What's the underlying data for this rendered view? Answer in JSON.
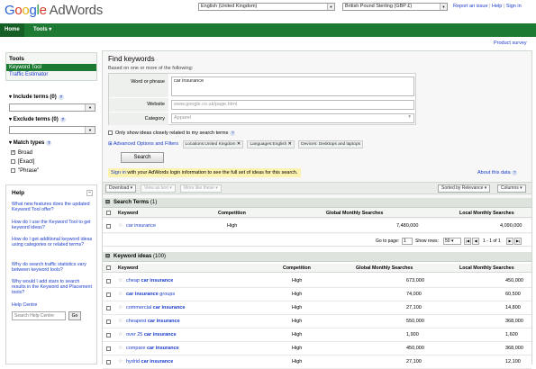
{
  "header": {
    "logo_google": [
      "G",
      "o",
      "o",
      "g",
      "l",
      "e"
    ],
    "logo_product": "AdWords",
    "language": "English (United Kingdom)",
    "currency": "British Pound Sterling (GBP £)",
    "links": [
      "Report an issue",
      "Help",
      "Sign in"
    ],
    "sep": "|"
  },
  "nav": {
    "home": "Home",
    "tools": "Tools"
  },
  "survey": "Product survey",
  "sidebar": {
    "tools_title": "Tools",
    "keyword_tool": "Keyword Tool",
    "traffic_estimator": "Traffic Estimator",
    "include_terms": "Include terms (0)",
    "exclude_terms": "Exclude terms (0)",
    "match_types": "Match types",
    "match_options": [
      {
        "label": "Broad",
        "checked": true
      },
      {
        "label": "[Exact]",
        "checked": false
      },
      {
        "label": "\"Phrase\"",
        "checked": false
      }
    ],
    "help_title": "Help",
    "help_links": [
      "What new features does the updated Keyword Tool offer?",
      "How do I use the Keyword Tool to get keyword ideas?",
      "How do I get additional keyword ideas using categories or related terms?",
      "Why do search traffic statistics vary between keyword tools?",
      "Why would I add stars to search results in the Keyword and Placement tools?",
      "Help Centre"
    ],
    "help_search_placeholder": "Search Help Centre",
    "go": "Go"
  },
  "find": {
    "title": "Find keywords",
    "subtitle": "Based on one or more of the following:",
    "word_label": "Word or phrase",
    "word_value": "car insurance",
    "website_label": "Website",
    "website_placeholder": "www.google.co.uk/page.html",
    "category_label": "Category",
    "category_placeholder": "Apparel",
    "only_closely": "Only show ideas closely related to my search terms",
    "advanced": "Advanced Options and Filters",
    "chips": [
      "Locations:United Kingdom",
      "Languages:English",
      "Devices: Desktops and laptops"
    ],
    "search_btn": "Search",
    "signin_link": "Sign in",
    "signin_text": " with your AdWords login information to see the full set of ideas for this search.",
    "about": "About this data"
  },
  "toolbar": {
    "download": "Download",
    "view_as_text": "View as text",
    "more_like_these": "More like these",
    "sort": "Sorted by Relevance",
    "columns": "Columns"
  },
  "search_terms": {
    "title": "Search Terms",
    "count": "(1)",
    "headers": [
      "Keyword",
      "Competition",
      "Global Monthly Searches",
      "Local Monthly Searches"
    ],
    "rows": [
      {
        "keyword": "car insurance",
        "competition": "High",
        "global": "7,480,000",
        "local": "4,090,000"
      }
    ]
  },
  "pager": {
    "goto": "Go to page:",
    "page": "1",
    "show_rows": "Show rows:",
    "rows": "50",
    "range": "1 - 1 of 1"
  },
  "keyword_ideas": {
    "title": "Keyword ideas",
    "count": "(100)",
    "headers": [
      "Keyword",
      "Competition",
      "Global Monthly Searches",
      "Local Monthly Searches"
    ],
    "rows": [
      {
        "pre": "cheap ",
        "kw": "car insurance",
        "post": "",
        "competition": "High",
        "global": "673,000",
        "local": "450,000"
      },
      {
        "pre": "",
        "kw": "car insurance",
        "post": " groups",
        "competition": "High",
        "global": "74,000",
        "local": "60,500"
      },
      {
        "pre": "commercial ",
        "kw": "car insurance",
        "post": "",
        "competition": "High",
        "global": "27,100",
        "local": "14,800"
      },
      {
        "pre": "cheapest ",
        "kw": "car insurance",
        "post": "",
        "competition": "High",
        "global": "550,000",
        "local": "368,000"
      },
      {
        "pre": "over 25 ",
        "kw": "car insurance",
        "post": "",
        "competition": "High",
        "global": "1,900",
        "local": "1,600"
      },
      {
        "pre": "compare ",
        "kw": "car insurance",
        "post": "",
        "competition": "High",
        "global": "450,000",
        "local": "368,000"
      },
      {
        "pre": "hydrid ",
        "kw": "car insurance",
        "post": "",
        "competition": "High",
        "global": "27,100",
        "local": "12,100"
      }
    ]
  }
}
